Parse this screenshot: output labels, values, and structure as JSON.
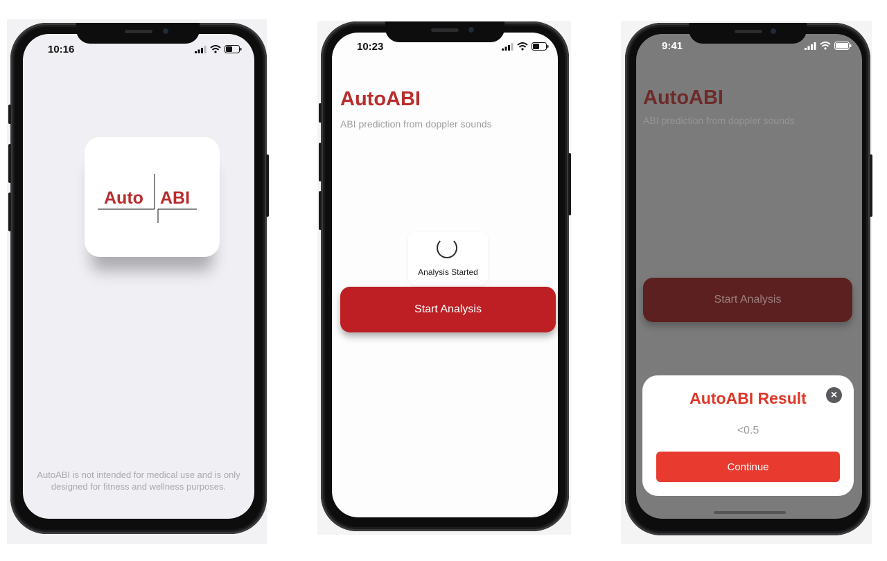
{
  "phone1": {
    "status": {
      "time": "10:16"
    },
    "logo": {
      "left_word": "Auto",
      "right_word": "ABI",
      "brand_color": "#b92d2d"
    },
    "disclaimer": "AutoABI is not intended for medical use and is only designed for fitness and wellness purposes."
  },
  "phone2": {
    "status": {
      "time": "10:23"
    },
    "title": "AutoABI",
    "subtitle": "ABI prediction from doppler sounds",
    "toast_label": "Analysis Started",
    "start_button": "Start Analysis",
    "accent_color": "#bd1f24"
  },
  "phone3": {
    "status": {
      "time": "9:41"
    },
    "title": "AutoABI",
    "subtitle": "ABI prediction from doppler sounds",
    "start_button": "Start Analysis",
    "result": {
      "title": "AutoABI Result",
      "value": "<0.5",
      "continue_button": "Continue",
      "close_icon": "close-icon",
      "accent_color": "#e83a2f"
    }
  },
  "icons": {
    "cellular": "cellular-signal-icon",
    "wifi": "wifi-icon",
    "battery": "battery-icon"
  }
}
